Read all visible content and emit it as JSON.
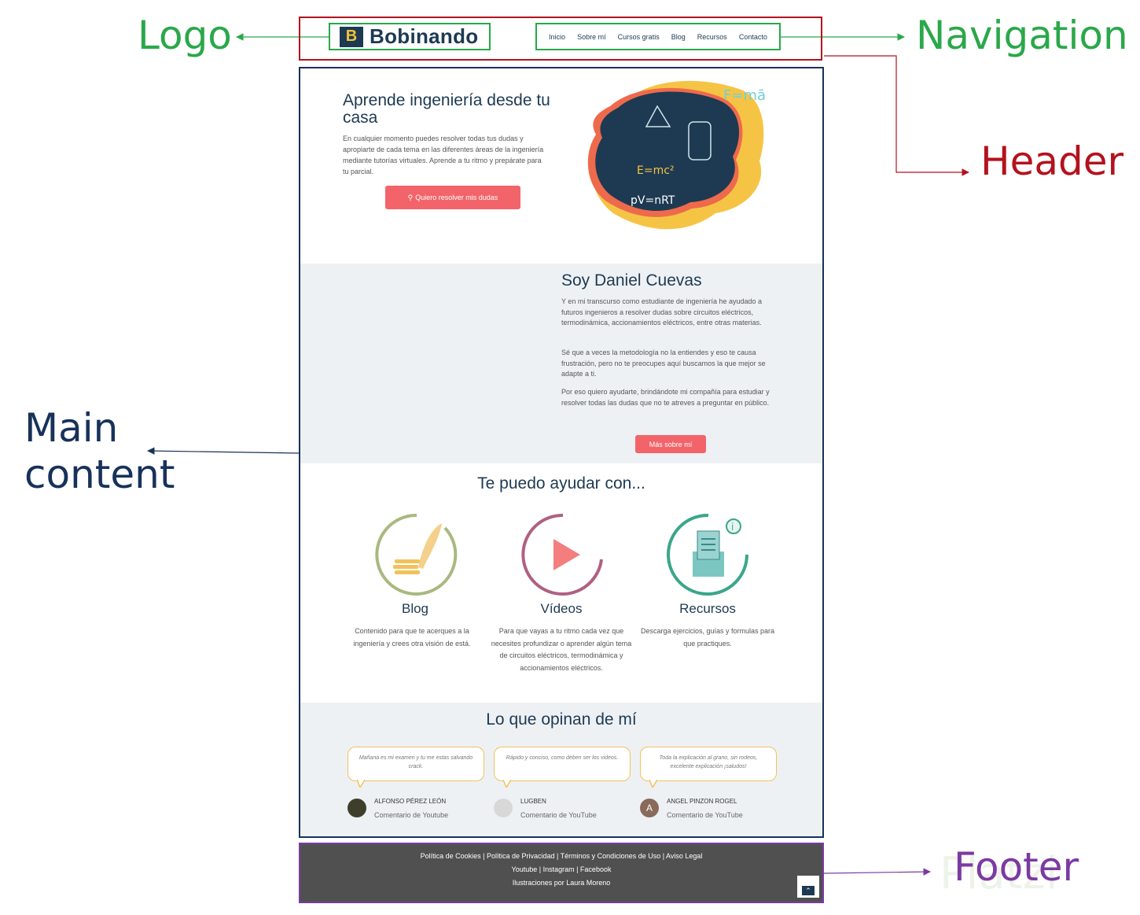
{
  "callouts": {
    "logo": "Logo",
    "navigation": "Navigation",
    "header": "Header",
    "main_line1": "Main",
    "main_line2": "content",
    "footer": "Footer"
  },
  "colors": {
    "logo": "#2aa84a",
    "navigation": "#2aa84a",
    "header": "#b3121e",
    "main": "#17325a",
    "footer": "#7b3aa2"
  },
  "site": {
    "logo_mark": "B",
    "logo_text": "Bobinando",
    "nav": [
      "Inicio",
      "Sobre mí",
      "Cursos gratis",
      "Blog",
      "Recursos",
      "Contacto"
    ],
    "hero": {
      "title": "Aprende ingeniería desde tu casa",
      "text": "En cualquier momento puedes resolver todas tus dudas y apropiarte de cada tema en las diferentes áreas de la ingeniería mediante tutorías virtuales. Aprende a tu ritmo y prepárate para tu parcial.",
      "button": "Quiero resolver mis dudas",
      "formulas": [
        "F=mā",
        "E=mc²",
        "pV=nRT"
      ]
    },
    "about": {
      "title": "Soy Daniel Cuevas",
      "p1": "Y en mi transcurso como estudiante de ingeniería he ayudado a futuros ingenieros a resolver dudas sobre circuitos eléctricos, termodinámica, accionamientos eléctricos, entre otras materias.",
      "p2": "Sé que a veces la metodología no la entiendes y eso te causa frustración, pero no te preocupes aquí buscamos la que mejor se adapte a ti.",
      "p3": "Por eso quiero ayudarte, brindándote mi compañía para estudiar y resolver todas las dudas que no te atreves a preguntar en público.",
      "button": "Más sobre mí"
    },
    "help": {
      "title": "Te puedo ayudar con...",
      "services": [
        {
          "title": "Blog",
          "desc": "Contenido para que te acerques a la ingeniería y crees otra visión de está.",
          "icon": "quill-icon"
        },
        {
          "title": "Vídeos",
          "desc": "Para que vayas a tu ritmo cada vez que necesites profundizar o aprender algún tema de circuitos eléctricos, termodinámica y accionamientos eléctricos.",
          "icon": "play-icon"
        },
        {
          "title": "Recursos",
          "desc": "Descarga ejercicios, guías y formulas para que practiques.",
          "icon": "box-icon"
        }
      ]
    },
    "opinions": {
      "title": "Lo que opinan de mí",
      "reviews": [
        {
          "quote": "Mañana es mi examen y tu me estas salvando crack.",
          "name": "ALFONSO PÉREZ LEÓN",
          "source": "Comentario de Youtube"
        },
        {
          "quote": "Rápido y conciso, como deben ser los videos.",
          "name": "LUGBEN",
          "source": "Comentario de YouTube"
        },
        {
          "quote": "Toda la explicación al grano, sin rodeos, excelente explicación ¡saludos!",
          "name": "ANGEL PINZON ROGEL",
          "source": "Comentario de YouTube",
          "initial": "A"
        }
      ]
    },
    "footer": {
      "line1": "Política de Cookies | Política de Privacidad | Términos y Condiciones de Uso | Aviso Legal",
      "line2": "Youtube | Instagram | Facebook",
      "line3": "Ilustraciones por Laura Moreno"
    }
  },
  "watermark": "Platzi"
}
